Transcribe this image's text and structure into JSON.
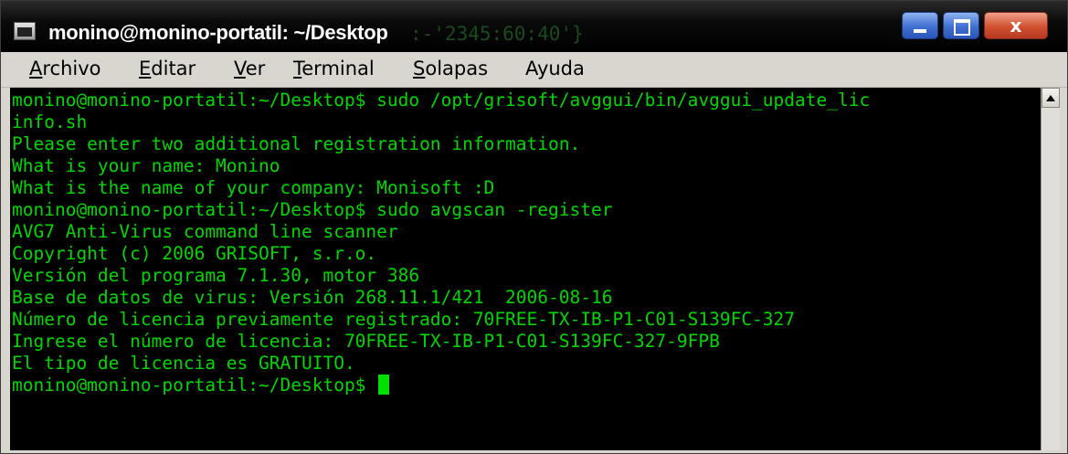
{
  "window": {
    "title": "monino@monino-portatil: ~/Desktop",
    "ghost_text": ":-'2345:60:40'}",
    "icon": "terminal-icon",
    "buttons": {
      "minimize_icon": "minimize-icon",
      "maximize_icon": "maximize-icon",
      "close_label": "x"
    }
  },
  "menubar": {
    "items": [
      {
        "mnemonic": "A",
        "rest": "rchivo"
      },
      {
        "mnemonic": "E",
        "rest": "ditar"
      },
      {
        "mnemonic": "V",
        "rest": "er"
      },
      {
        "mnemonic": "T",
        "rest": "erminal"
      },
      {
        "mnemonic": "S",
        "rest": "olapas"
      },
      {
        "mnemonic": "",
        "rest": "Ayuda"
      }
    ]
  },
  "terminal": {
    "text_color": "#00d700",
    "background": "#000000",
    "lines": [
      "monino@monino-portatil:~/Desktop$ sudo /opt/grisoft/avggui/bin/avggui_update_lic",
      "info.sh",
      "Please enter two additional registration information.",
      "What is your name: Monino",
      "What is the name of your company: Monisoft :D",
      "monino@monino-portatil:~/Desktop$ sudo avgscan -register",
      "AVG7 Anti-Virus command line scanner",
      "Copyright (c) 2006 GRISOFT, s.r.o.",
      "Versión del programa 7.1.30, motor 386",
      "Base de datos de virus: Versión 268.11.1/421  2006-08-16",
      "Número de licencia previamente registrado: 70FREE-TX-IB-P1-C01-S139FC-327",
      "Ingrese el número de licencia: 70FREE-TX-IB-P1-C01-S139FC-327-9FPB",
      "El tipo de licencia es GRATUITO.",
      "monino@monino-portatil:~/Desktop$ "
    ]
  },
  "scrollbar": {
    "up_icon": "arrow-up-icon"
  }
}
